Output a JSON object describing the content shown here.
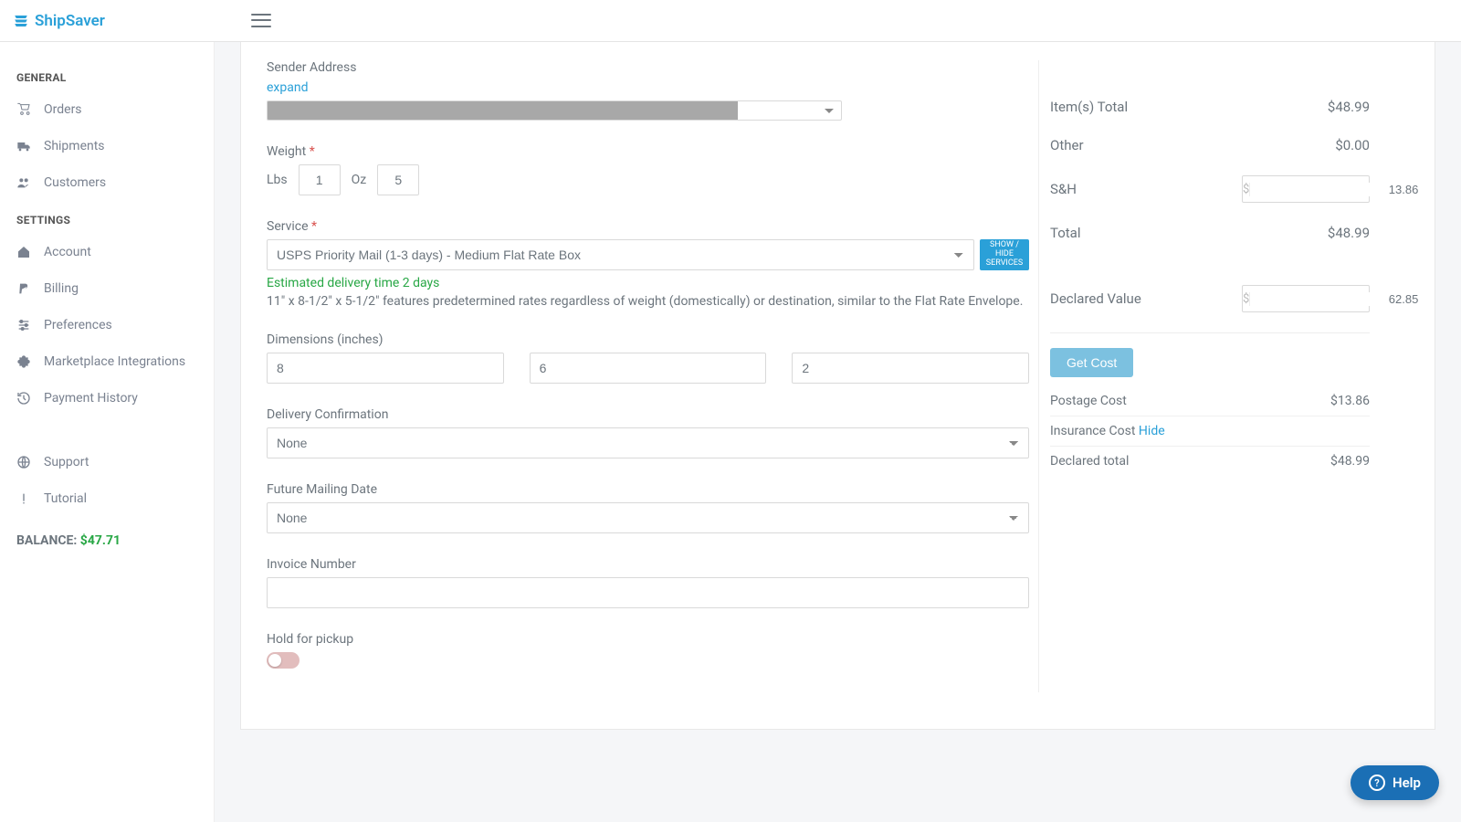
{
  "brand": {
    "name": "ShipSaver"
  },
  "sidebar": {
    "heading_general": "GENERAL",
    "heading_settings": "SETTINGS",
    "items_general": [
      {
        "label": "Orders",
        "icon": "cart-icon"
      },
      {
        "label": "Shipments",
        "icon": "truck-icon"
      },
      {
        "label": "Customers",
        "icon": "users-icon"
      }
    ],
    "items_settings": [
      {
        "label": "Account",
        "icon": "home-icon"
      },
      {
        "label": "Billing",
        "icon": "paypal-icon"
      },
      {
        "label": "Preferences",
        "icon": "sliders-icon"
      },
      {
        "label": "Marketplace Integrations",
        "icon": "puzzle-icon"
      },
      {
        "label": "Payment History",
        "icon": "history-icon"
      }
    ],
    "items_footer": [
      {
        "label": "Support",
        "icon": "globe-icon"
      },
      {
        "label": "Tutorial",
        "icon": "exclamation-icon"
      }
    ],
    "balance_label": "BALANCE:",
    "balance_value": "$47.71"
  },
  "form": {
    "sender_label": "Sender Address",
    "expand": "expand",
    "weight_label": "Weight",
    "lbs_label": "Lbs",
    "lbs_value": "1",
    "oz_label": "Oz",
    "oz_value": "5",
    "service_label": "Service",
    "service_value": "USPS Priority Mail (1-3 days) - Medium Flat Rate Box",
    "show_hide": "SHOW / HIDE SERVICES",
    "est_delivery": "Estimated delivery time 2 days",
    "service_desc": "11\" x 8-1/2\" x 5-1/2\" features predetermined rates regardless of weight (domestically) or destination, similar to the Flat Rate Envelope.",
    "dims_label": "Dimensions (inches)",
    "dim_l": "8",
    "dim_w": "6",
    "dim_h": "2",
    "delivery_conf_label": "Delivery Confirmation",
    "delivery_conf_value": "None",
    "future_mail_label": "Future Mailing Date",
    "future_mail_value": "None",
    "invoice_label": "Invoice Number",
    "invoice_value": "",
    "hold_label": "Hold for pickup"
  },
  "summary": {
    "items_total_label": "Item(s) Total",
    "items_total_value": "$48.99",
    "other_label": "Other",
    "other_value": "$0.00",
    "sh_label": "S&H",
    "sh_value": "13.86",
    "total_label": "Total",
    "total_value": "$48.99",
    "declared_label": "Declared Value",
    "declared_value": "62.85",
    "get_cost": "Get Cost",
    "postage_label": "Postage Cost",
    "postage_value": "$13.86",
    "insurance_label": "Insurance Cost",
    "insurance_hide": "Hide",
    "declared_total_label": "Declared total",
    "declared_total_value": "$48.99",
    "currency": "$"
  },
  "help": {
    "label": "Help"
  }
}
